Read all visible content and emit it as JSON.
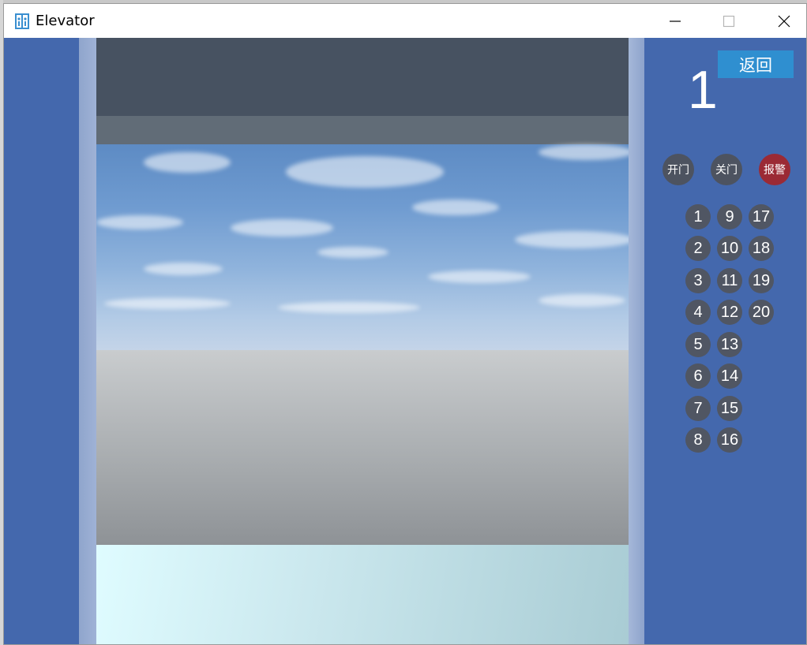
{
  "window": {
    "title": "Elevator"
  },
  "panel": {
    "back_label": "返回",
    "current_floor": "1",
    "controls": [
      {
        "label": "开门",
        "name": "open-door-button"
      },
      {
        "label": "关门",
        "name": "close-door-button"
      },
      {
        "label": "报警",
        "name": "alarm-button"
      }
    ],
    "floors": [
      "1",
      "2",
      "3",
      "4",
      "5",
      "6",
      "7",
      "8",
      "9",
      "10",
      "11",
      "12",
      "13",
      "14",
      "15",
      "16",
      "17",
      "18",
      "19",
      "20"
    ]
  },
  "colors": {
    "wall": "#4468ad",
    "back_button": "#2f8fd0",
    "alarm": "#9b2a35",
    "floor_button": "#505663"
  },
  "icons": {
    "app": "elevator-icon",
    "minimize": "minimize-icon",
    "maximize": "maximize-icon",
    "close": "close-icon"
  }
}
